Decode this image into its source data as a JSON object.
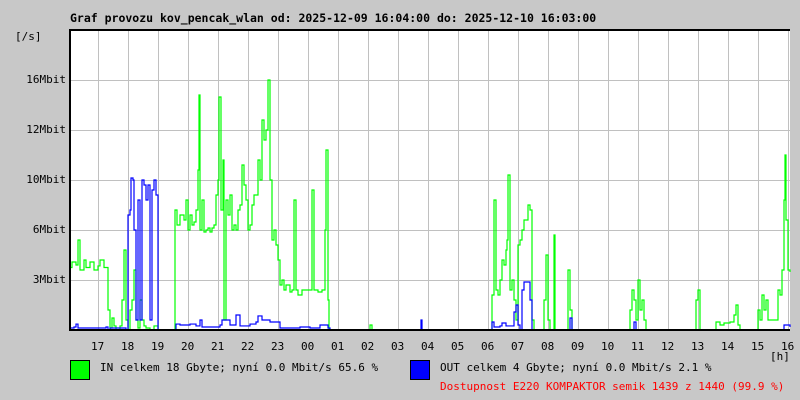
{
  "title": "Graf provozu kov_pencak_wlan od: 2025-12-09 16:04:00 do: 2025-12-10 16:03:00",
  "colors": {
    "in": "#00ff00",
    "out": "#0000ff",
    "grid": "#c0c0c0",
    "availability": "#ff0000"
  },
  "legend": {
    "in_text": "IN celkem 18 Gbyte; nyní   0.0 Mbit/s 65.6 %",
    "out_text": "OUT celkem 4 Gbyte; nyní   0.0 Mbit/s 2.1 %",
    "availability": "Dostupnost E220 KOMPAKTOR semik 1439 z 1440 (99.9 %)"
  },
  "chart_data": {
    "type": "line",
    "title": "Graf provozu kov_pencak_wlan od: 2025-12-09 16:04:00 do: 2025-12-10 16:03:00",
    "ylabel": "[/s]",
    "xlabel": "[h]",
    "x_unit": "minutes since 2025-12-09 16:04",
    "xlim": [
      0,
      1440
    ],
    "ylim": [
      0,
      19.2
    ],
    "grid": true,
    "y_ticks": [
      {
        "value": 3.2,
        "label": "3Mbit"
      },
      {
        "value": 6.4,
        "label": "6Mbit"
      },
      {
        "value": 9.6,
        "label": "10Mbit"
      },
      {
        "value": 12.8,
        "label": "12Mbit"
      },
      {
        "value": 16.0,
        "label": "16Mbit"
      }
    ],
    "x_ticks": [
      {
        "value": 56,
        "label": "17"
      },
      {
        "value": 116,
        "label": "18"
      },
      {
        "value": 176,
        "label": "19"
      },
      {
        "value": 236,
        "label": "20"
      },
      {
        "value": 296,
        "label": "21"
      },
      {
        "value": 356,
        "label": "22"
      },
      {
        "value": 416,
        "label": "23"
      },
      {
        "value": 476,
        "label": "00"
      },
      {
        "value": 536,
        "label": "01"
      },
      {
        "value": 596,
        "label": "02"
      },
      {
        "value": 656,
        "label": "03"
      },
      {
        "value": 716,
        "label": "04"
      },
      {
        "value": 776,
        "label": "05"
      },
      {
        "value": 836,
        "label": "06"
      },
      {
        "value": 896,
        "label": "07"
      },
      {
        "value": 956,
        "label": "08"
      },
      {
        "value": 1016,
        "label": "09"
      },
      {
        "value": 1076,
        "label": "10"
      },
      {
        "value": 1136,
        "label": "11"
      },
      {
        "value": 1196,
        "label": "12"
      },
      {
        "value": 1256,
        "label": "13"
      },
      {
        "value": 1316,
        "label": "14"
      },
      {
        "value": 1376,
        "label": "15"
      },
      {
        "value": 1436,
        "label": "16"
      }
    ],
    "series": [
      {
        "name": "IN",
        "unit": "Mbit/s",
        "points": [
          [
            0,
            4.0
          ],
          [
            4,
            4.35
          ],
          [
            12,
            4.16
          ],
          [
            16,
            5.76
          ],
          [
            20,
            3.84
          ],
          [
            28,
            4.48
          ],
          [
            32,
            4.0
          ],
          [
            40,
            4.35
          ],
          [
            48,
            3.84
          ],
          [
            56,
            4.1
          ],
          [
            60,
            4.48
          ],
          [
            68,
            4.0
          ],
          [
            74,
            4.0
          ],
          [
            76,
            1.28
          ],
          [
            80,
            0.13
          ],
          [
            84,
            0.77
          ],
          [
            88,
            0.26
          ],
          [
            92,
            0
          ],
          [
            100,
            0.26
          ],
          [
            104,
            1.92
          ],
          [
            108,
            5.12
          ],
          [
            112,
            0.64
          ],
          [
            116,
            0
          ],
          [
            120,
            1.28
          ],
          [
            124,
            1.92
          ],
          [
            128,
            3.84
          ],
          [
            132,
            0.64
          ],
          [
            136,
            0.13
          ],
          [
            140,
            1.92
          ],
          [
            144,
            0.64
          ],
          [
            148,
            0.26
          ],
          [
            152,
            0.13
          ],
          [
            160,
            0
          ],
          [
            168,
            0.26
          ],
          [
            176,
            0
          ],
          [
            208,
            0
          ],
          [
            210,
            7.68
          ],
          [
            214,
            6.72
          ],
          [
            220,
            7.36
          ],
          [
            228,
            7.04
          ],
          [
            232,
            8.32
          ],
          [
            236,
            6.4
          ],
          [
            240,
            7.36
          ],
          [
            244,
            6.72
          ],
          [
            248,
            6.91
          ],
          [
            252,
            7.68
          ],
          [
            256,
            10.24
          ],
          [
            258,
            15.04
          ],
          [
            260,
            6.4
          ],
          [
            264,
            8.32
          ],
          [
            268,
            6.27
          ],
          [
            272,
            6.4
          ],
          [
            276,
            6.53
          ],
          [
            280,
            6.27
          ],
          [
            284,
            6.53
          ],
          [
            288,
            6.72
          ],
          [
            292,
            8.64
          ],
          [
            296,
            9.6
          ],
          [
            298,
            14.91
          ],
          [
            302,
            7.68
          ],
          [
            306,
            10.88
          ],
          [
            308,
            0.64
          ],
          [
            312,
            8.32
          ],
          [
            316,
            7.36
          ],
          [
            320,
            8.64
          ],
          [
            324,
            6.4
          ],
          [
            328,
            6.72
          ],
          [
            332,
            6.4
          ],
          [
            336,
            7.68
          ],
          [
            340,
            8.0
          ],
          [
            344,
            10.56
          ],
          [
            348,
            9.28
          ],
          [
            352,
            8.32
          ],
          [
            356,
            6.4
          ],
          [
            360,
            6.72
          ],
          [
            364,
            8.0
          ],
          [
            368,
            8.64
          ],
          [
            376,
            10.88
          ],
          [
            380,
            9.6
          ],
          [
            384,
            13.44
          ],
          [
            388,
            12.16
          ],
          [
            392,
            12.8
          ],
          [
            396,
            16.0
          ],
          [
            400,
            9.6
          ],
          [
            404,
            5.76
          ],
          [
            408,
            6.4
          ],
          [
            412,
            5.44
          ],
          [
            416,
            4.48
          ],
          [
            420,
            2.88
          ],
          [
            424,
            3.2
          ],
          [
            428,
            2.56
          ],
          [
            432,
            2.88
          ],
          [
            440,
            2.43
          ],
          [
            444,
            2.56
          ],
          [
            448,
            8.32
          ],
          [
            452,
            2.56
          ],
          [
            456,
            2.24
          ],
          [
            464,
            2.56
          ],
          [
            472,
            2.56
          ],
          [
            480,
            2.56
          ],
          [
            484,
            8.96
          ],
          [
            488,
            2.56
          ],
          [
            496,
            2.43
          ],
          [
            504,
            2.56
          ],
          [
            510,
            6.4
          ],
          [
            512,
            11.52
          ],
          [
            516,
            1.92
          ],
          [
            518,
            0
          ],
          [
            600,
            0.32
          ],
          [
            604,
            0
          ],
          [
            840,
            0
          ],
          [
            844,
            2.24
          ],
          [
            848,
            8.32
          ],
          [
            852,
            2.56
          ],
          [
            856,
            2.24
          ],
          [
            860,
            3.2
          ],
          [
            864,
            4.48
          ],
          [
            868,
            4.16
          ],
          [
            872,
            5.12
          ],
          [
            874,
            5.76
          ],
          [
            876,
            9.92
          ],
          [
            880,
            2.56
          ],
          [
            884,
            3.2
          ],
          [
            888,
            1.92
          ],
          [
            892,
            0.64
          ],
          [
            896,
            5.44
          ],
          [
            900,
            5.76
          ],
          [
            904,
            6.4
          ],
          [
            908,
            7.04
          ],
          [
            912,
            7.04
          ],
          [
            916,
            8.0
          ],
          [
            920,
            7.68
          ],
          [
            924,
            0.64
          ],
          [
            928,
            0
          ],
          [
            948,
            1.92
          ],
          [
            952,
            4.8
          ],
          [
            956,
            0.64
          ],
          [
            960,
            0
          ],
          [
            968,
            6.08
          ],
          [
            970,
            0
          ],
          [
            996,
            3.84
          ],
          [
            1000,
            1.28
          ],
          [
            1004,
            0
          ],
          [
            1116,
            0
          ],
          [
            1120,
            1.28
          ],
          [
            1124,
            2.56
          ],
          [
            1128,
            1.92
          ],
          [
            1132,
            0.64
          ],
          [
            1136,
            3.2
          ],
          [
            1140,
            1.28
          ],
          [
            1144,
            1.92
          ],
          [
            1148,
            0.64
          ],
          [
            1152,
            0
          ],
          [
            1248,
            0
          ],
          [
            1252,
            1.92
          ],
          [
            1256,
            2.56
          ],
          [
            1260,
            0
          ],
          [
            1288,
            0
          ],
          [
            1292,
            0.51
          ],
          [
            1300,
            0.32
          ],
          [
            1308,
            0.45
          ],
          [
            1320,
            0.51
          ],
          [
            1328,
            0.96
          ],
          [
            1332,
            1.6
          ],
          [
            1336,
            0.32
          ],
          [
            1340,
            0
          ],
          [
            1372,
            0
          ],
          [
            1376,
            1.28
          ],
          [
            1380,
            0.64
          ],
          [
            1384,
            2.24
          ],
          [
            1388,
            1.28
          ],
          [
            1392,
            1.92
          ],
          [
            1396,
            0.64
          ],
          [
            1404,
            0.64
          ],
          [
            1416,
            2.56
          ],
          [
            1420,
            2.24
          ],
          [
            1424,
            3.84
          ],
          [
            1428,
            8.32
          ],
          [
            1430,
            11.2
          ],
          [
            1432,
            7.04
          ],
          [
            1436,
            3.84
          ],
          [
            1440,
            3.71
          ]
        ]
      },
      {
        "name": "OUT",
        "unit": "Mbit/s",
        "points": [
          [
            0,
            0.13
          ],
          [
            8,
            0.19
          ],
          [
            12,
            0.38
          ],
          [
            16,
            0.13
          ],
          [
            40,
            0.13
          ],
          [
            72,
            0.19
          ],
          [
            76,
            0
          ],
          [
            80,
            0.13
          ],
          [
            112,
            0
          ],
          [
            116,
            7.36
          ],
          [
            120,
            7.68
          ],
          [
            122,
            9.73
          ],
          [
            126,
            9.6
          ],
          [
            128,
            6.4
          ],
          [
            132,
            0.64
          ],
          [
            136,
            8.32
          ],
          [
            140,
            0.64
          ],
          [
            144,
            9.6
          ],
          [
            148,
            9.28
          ],
          [
            152,
            8.32
          ],
          [
            156,
            9.28
          ],
          [
            160,
            0.64
          ],
          [
            164,
            8.96
          ],
          [
            168,
            9.6
          ],
          [
            172,
            8.64
          ],
          [
            176,
            0
          ],
          [
            210,
            0
          ],
          [
            212,
            0.38
          ],
          [
            220,
            0.32
          ],
          [
            240,
            0.38
          ],
          [
            252,
            0.26
          ],
          [
            260,
            0.64
          ],
          [
            264,
            0.19
          ],
          [
            300,
            0.32
          ],
          [
            304,
            0.64
          ],
          [
            320,
            0.32
          ],
          [
            332,
            0.96
          ],
          [
            340,
            0.26
          ],
          [
            360,
            0.38
          ],
          [
            372,
            0.51
          ],
          [
            376,
            0.9
          ],
          [
            384,
            0.64
          ],
          [
            400,
            0.51
          ],
          [
            420,
            0.13
          ],
          [
            460,
            0.19
          ],
          [
            480,
            0.13
          ],
          [
            500,
            0.32
          ],
          [
            516,
            0.13
          ],
          [
            520,
            0
          ],
          [
            700,
            0
          ],
          [
            702,
            0.64
          ],
          [
            704,
            0
          ],
          [
            840,
            0
          ],
          [
            844,
            0.51
          ],
          [
            848,
            0.19
          ],
          [
            860,
            0.26
          ],
          [
            864,
            0.45
          ],
          [
            872,
            0.26
          ],
          [
            884,
            0.26
          ],
          [
            888,
            1.15
          ],
          [
            892,
            1.6
          ],
          [
            896,
            0.32
          ],
          [
            900,
            0
          ],
          [
            904,
            2.56
          ],
          [
            908,
            3.07
          ],
          [
            916,
            3.07
          ],
          [
            920,
            1.92
          ],
          [
            924,
            0
          ],
          [
            996,
            0
          ],
          [
            1000,
            0.77
          ],
          [
            1004,
            0
          ],
          [
            1124,
            0
          ],
          [
            1128,
            0.51
          ],
          [
            1132,
            0
          ],
          [
            1420,
            0
          ],
          [
            1428,
            0.32
          ],
          [
            1440,
            0.19
          ]
        ]
      }
    ]
  }
}
